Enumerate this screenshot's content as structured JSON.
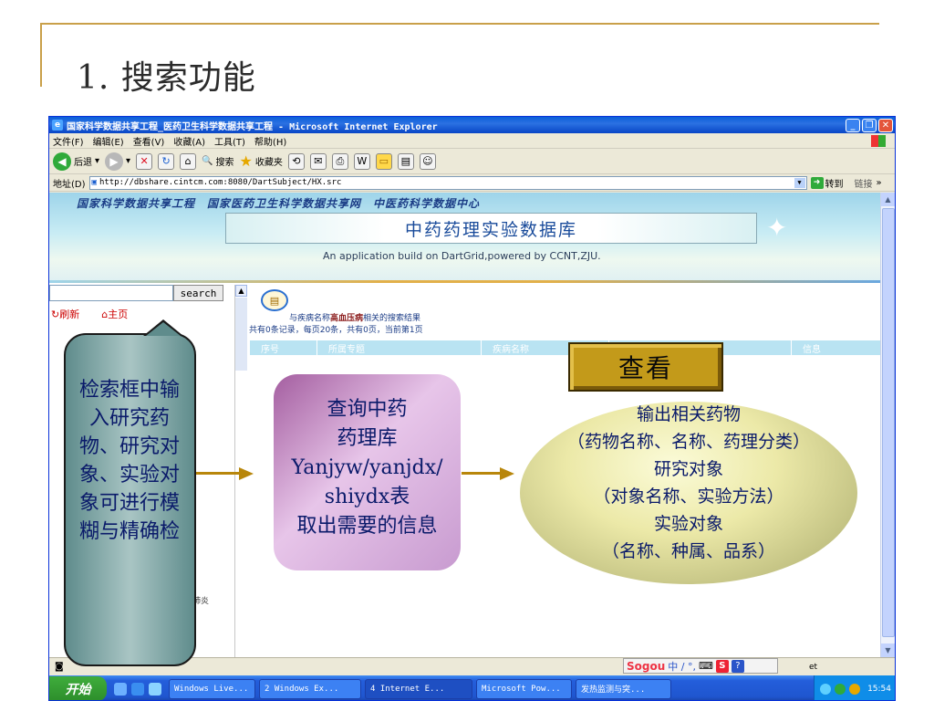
{
  "slide": {
    "title": "1. 搜索功能"
  },
  "browser": {
    "window_title": "国家科学数据共享工程_医药卫生科学数据共享工程 - Microsoft Internet Explorer",
    "menu": [
      "文件(F)",
      "编辑(E)",
      "查看(V)",
      "收藏(A)",
      "工具(T)",
      "帮助(H)"
    ],
    "toolbar": {
      "back": "后退",
      "search": "搜索",
      "favorites": "收藏夹"
    },
    "address": {
      "label": "地址(D)",
      "url": "http://dbshare.cintcm.com:8080/DartSubject/HX.src",
      "go": "转到",
      "links": "链接"
    }
  },
  "page": {
    "banner_top": "国家科学数据共享工程　国家医药卫生科学数据共享网　中医药科学数据中心",
    "banner_title": "中药药理实验数据库",
    "banner_subtitle": "An application build on DartGrid,powered by CCNT,ZJU.",
    "search_button": "search",
    "refresh_link": "刷新",
    "home_link": "主页",
    "result_summary_prefix": "与疾病名称",
    "result_summary_keyword": "高血压病",
    "result_summary_suffix": "相关的搜索结果",
    "result_counts": "共有0条记录，每页20条，共有0页，当前第1页",
    "table_headers": [
      "序号",
      "所属专题",
      "疾病名称",
      "",
      "信息"
    ],
    "left_tree_item": "肺炎"
  },
  "statusbar": {
    "sogou": "Sogou",
    "sogou_tail": "中 ∕ °, ",
    "status_tail": "et"
  },
  "taskbar": {
    "start": "开始",
    "tasks": [
      "Windows Live...",
      "2 Windows Ex...",
      "4 Internet E...",
      "Microsoft Pow...",
      "发热监测与突..."
    ],
    "clock": "15:54"
  },
  "annotations": {
    "left_callout": "检索框中输入研究药物、研究对象、实验对象可进行模糊与精确检",
    "middle_callout": "查询中药\n药理库\nYanjyw/yanjdx/\nshiydx表\n取出需要的信息",
    "view_box": "查看",
    "ellipse": "输出相关药物\n（药物名称、名称、药理分类）\n研究对象\n（对象名称、实验方法）\n实验对象\n（名称、种属、品系）"
  }
}
